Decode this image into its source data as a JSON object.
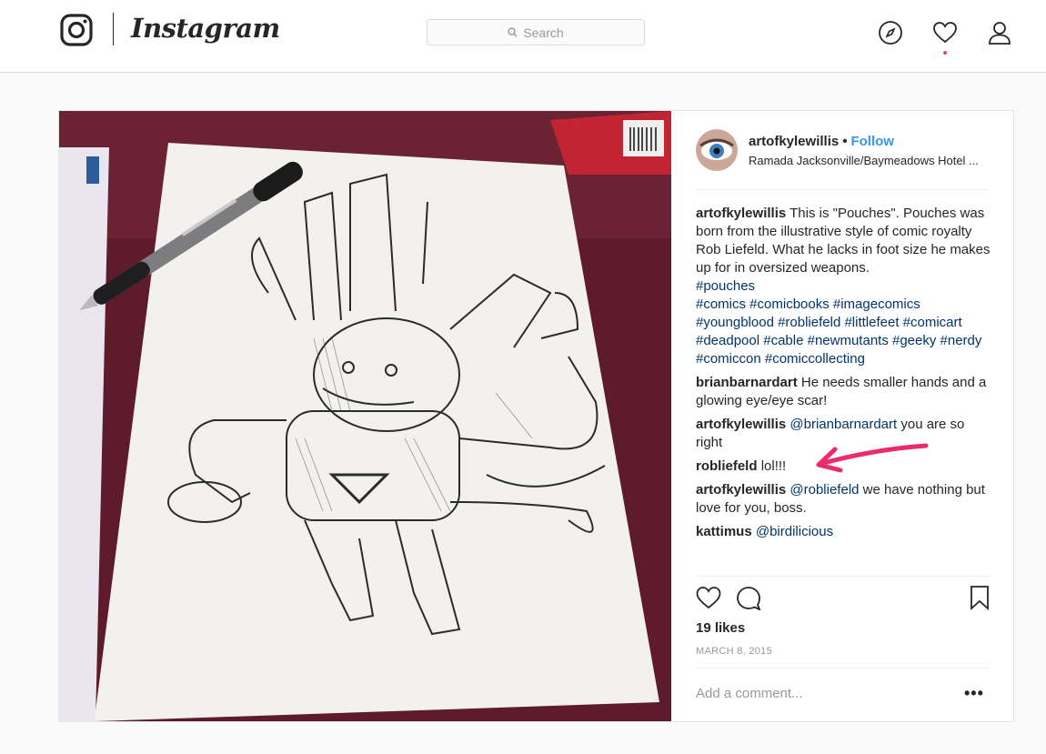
{
  "header": {
    "wordmark": "Instagram",
    "search_placeholder": "Search",
    "icons": [
      "instagram-glyph-icon",
      "compass-icon",
      "heart-icon",
      "profile-icon",
      "search-icon"
    ]
  },
  "post": {
    "author": "artofkylewillis",
    "separator": "•",
    "follow_label": "Follow",
    "location": "Ramada Jacksonville/Baymeadows Hotel ...",
    "caption": {
      "user": "artofkylewillis",
      "text": "This is \"Pouches\". Pouches was born from the illustrative style of comic royalty Rob Liefeld. What he lacks in foot size he makes up for in oversized weapons.",
      "tag1": "#pouches",
      "tags_line": "#comics #comicbooks #imagecomics #youngblood #robliefeld #littlefeet #comicart #deadpool #cable #newmutants #geeky #nerdy #comiccon #comiccollecting"
    },
    "comments": [
      {
        "user": "brianbarnardart",
        "mention": "",
        "text": "He needs smaller hands and a glowing eye/eye scar!"
      },
      {
        "user": "artofkylewillis",
        "mention": "@brianbarnardart",
        "text": "you are so right"
      },
      {
        "user": "robliefeld",
        "mention": "",
        "text": "lol!!!"
      },
      {
        "user": "artofkylewillis",
        "mention": "@robliefeld",
        "text": "we have nothing but love for you, boss."
      },
      {
        "user": "kattimus",
        "mention": "@birdilicious",
        "text": ""
      }
    ],
    "likes": "19 likes",
    "date": "MARCH 8, 2015",
    "add_comment_placeholder": "Add a comment...",
    "more_label": "•••"
  },
  "colors": {
    "link": "#3897f0",
    "hashtag": "#003569",
    "annotation_arrow": "#ed2a6e",
    "notification_dot": "#ed4956"
  }
}
